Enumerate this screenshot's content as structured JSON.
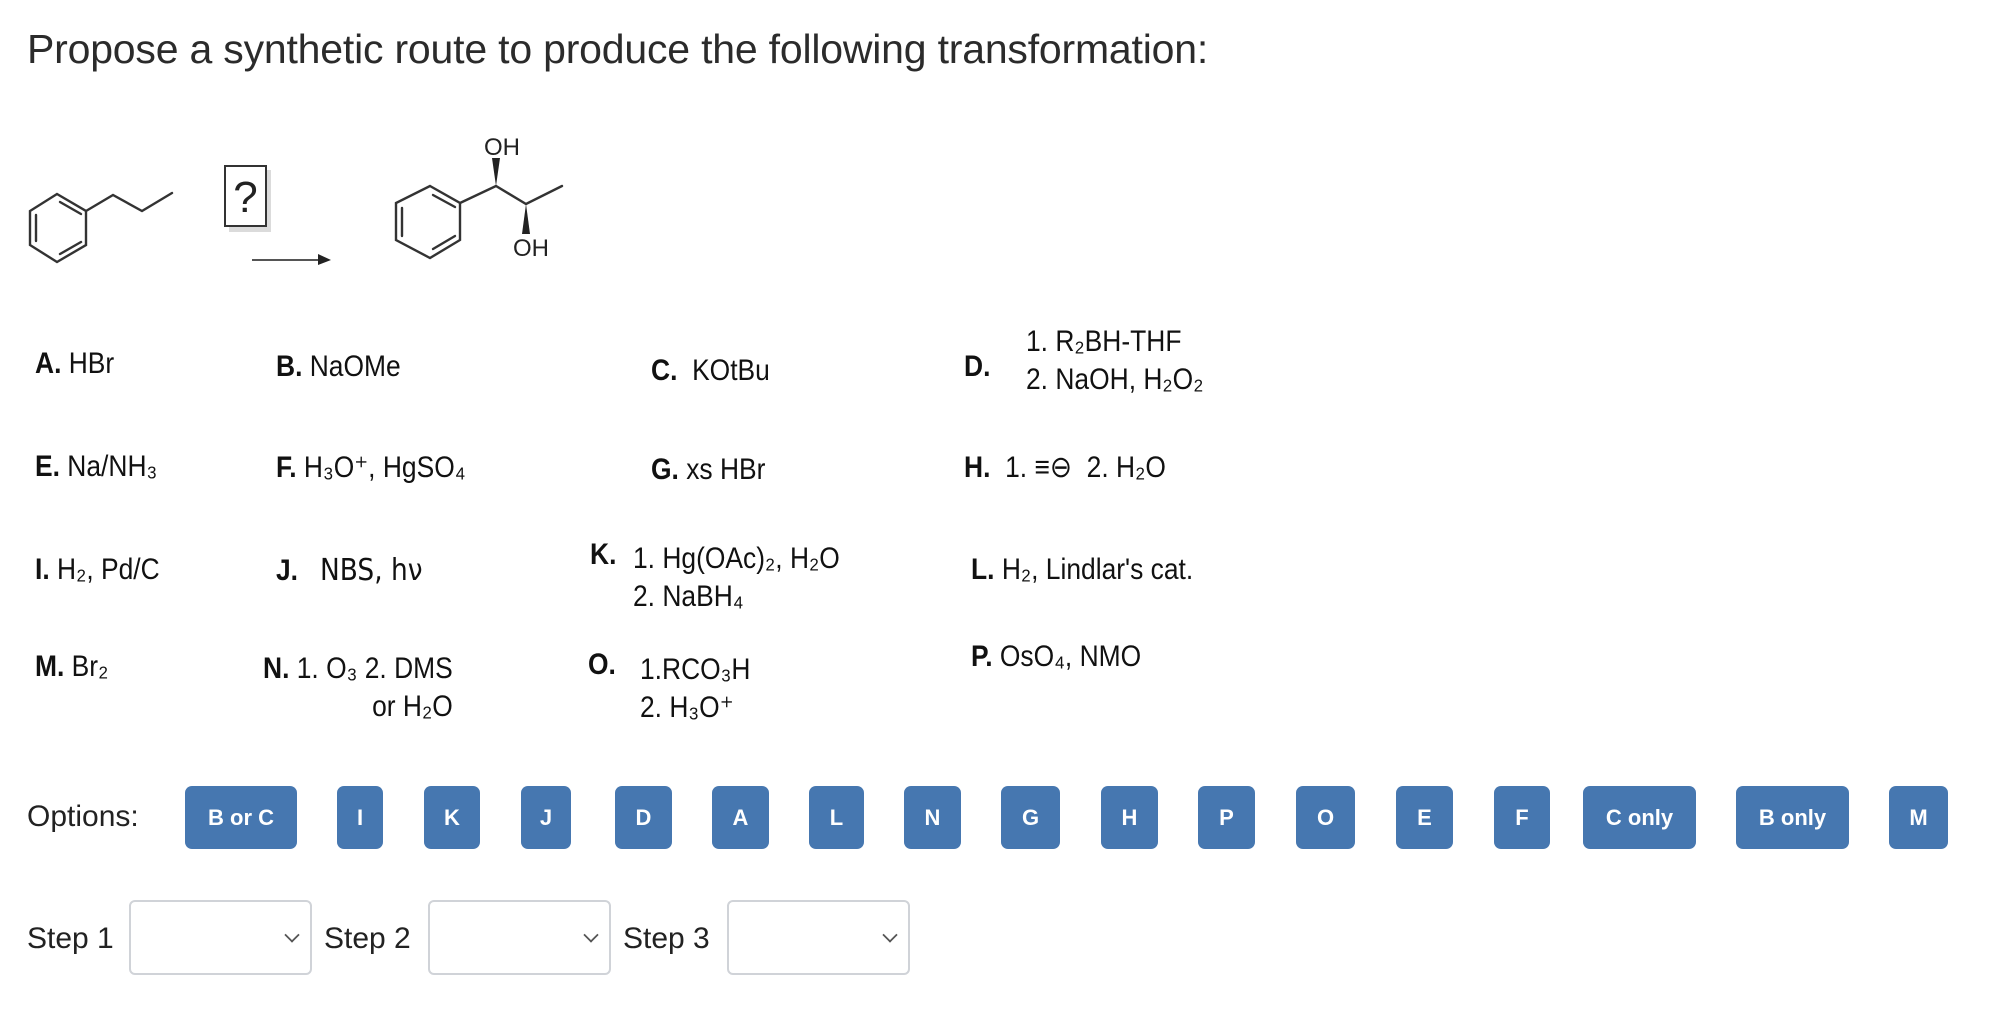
{
  "question": {
    "title": "Propose a synthetic route to produce the following transformation:"
  },
  "scheme": {
    "unknown_reagent": "?",
    "starting_material": "propylbenzene",
    "product": "1-phenylpropane-1,2-diol",
    "product_labels": {
      "oh_top": "OH",
      "oh_bottom": "OH"
    }
  },
  "reagents": [
    {
      "letter": "A.",
      "text": "HBr"
    },
    {
      "letter": "B.",
      "text": "NaOMe"
    },
    {
      "letter": "C.",
      "text": "KOtBu"
    },
    {
      "letter": "D.",
      "line1": "1. R₂BH-THF",
      "line2": "2. NaOH, H₂O₂"
    },
    {
      "letter": "E.",
      "text": "Na/NH₃"
    },
    {
      "letter": "F.",
      "text": "H₃O⁺, HgSO₄"
    },
    {
      "letter": "G.",
      "text": "xs HBr"
    },
    {
      "letter": "H.",
      "step1": "1.",
      "acetylide": "≡⊖",
      "step2": "2. H₂O"
    },
    {
      "letter": "I.",
      "text": "H₂, Pd/C"
    },
    {
      "letter": "J.",
      "text": "NBS, hν"
    },
    {
      "letter": "K.",
      "line1": "1. Hg(OAc)₂, H₂O",
      "line2": "2. NaBH₄"
    },
    {
      "letter": "L.",
      "text": "H₂, Lindlar's cat."
    },
    {
      "letter": "M.",
      "text": "Br₂"
    },
    {
      "letter": "N.",
      "line1": "1. O₃  2. DMS",
      "line2": "or H₂O"
    },
    {
      "letter": "O.",
      "line1": "1.RCO₃H",
      "line2": "2. H₃O⁺"
    },
    {
      "letter": "P.",
      "text": "OsO₄, NMO"
    }
  ],
  "options": {
    "label": "Options:",
    "buttons": [
      "B or C",
      "I",
      "K",
      "J",
      "D",
      "A",
      "L",
      "N",
      "G",
      "H",
      "P",
      "O",
      "E",
      "F",
      "C only",
      "B only",
      "M"
    ],
    "button_color": "#4677b0"
  },
  "steps": [
    {
      "label": "Step 1",
      "value": ""
    },
    {
      "label": "Step 2",
      "value": ""
    },
    {
      "label": "Step 3",
      "value": ""
    }
  ]
}
